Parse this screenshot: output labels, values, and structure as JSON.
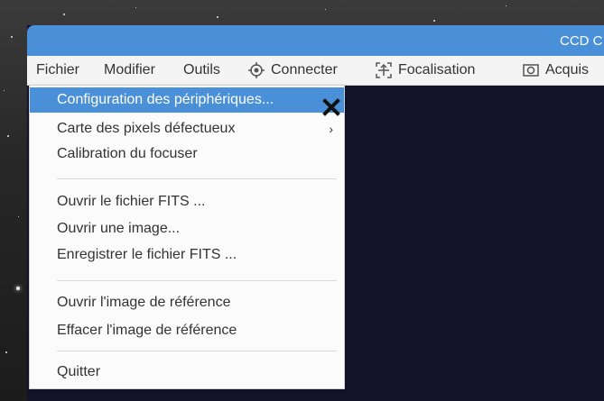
{
  "window": {
    "title": "CCD C"
  },
  "menubar": {
    "items": [
      {
        "label": "Fichier",
        "icon": ""
      },
      {
        "label": "Modifier",
        "icon": ""
      },
      {
        "label": "Outils",
        "icon": ""
      },
      {
        "label": "Connecter",
        "icon": "crosshair-icon"
      },
      {
        "label": "Focalisation",
        "icon": "focus-icon"
      },
      {
        "label": "Acquis",
        "icon": "camera-icon"
      }
    ]
  },
  "fichier_menu": {
    "items": [
      {
        "label": "Configuration des périphériques...",
        "highlighted": true
      },
      {
        "label": "Carte des pixels défectueux",
        "submenu_arrow": "›"
      },
      {
        "label": "Calibration du focuser"
      },
      {
        "label": "Ouvrir le fichier FITS ..."
      },
      {
        "label": "Ouvrir une image..."
      },
      {
        "label": "Enregistrer  le fichier FITS ..."
      },
      {
        "label": "Ouvrir l'image de référence"
      },
      {
        "label": "Effacer l'image de référence"
      },
      {
        "label": "Quitter"
      }
    ]
  },
  "colors": {
    "accent": "#4a90d8",
    "window_bg": "#15132a",
    "menu_bg": "#fbfbfb"
  }
}
